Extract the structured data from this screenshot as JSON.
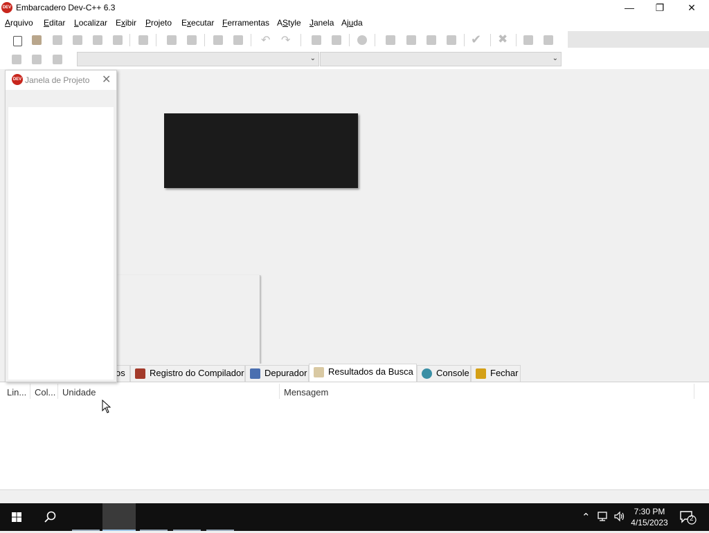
{
  "window": {
    "title": "Embarcadero Dev-C++ 6.3",
    "app_icon_text": "DEV C++",
    "minimize": "—",
    "restore": "❐",
    "close": "✕"
  },
  "menu": [
    {
      "label": "Arquivo",
      "key": "A",
      "rest": "rquivo"
    },
    {
      "label": "Editar",
      "key": "E",
      "rest": "ditar"
    },
    {
      "label": "Localizar",
      "key": "L",
      "rest": "ocalizar"
    },
    {
      "label": "Exibir",
      "pre": "E",
      "key": "x",
      "rest": "ibir"
    },
    {
      "label": "Projeto",
      "key": "P",
      "rest": "rojeto"
    },
    {
      "label": "Executar",
      "pre": "E",
      "key": "x",
      "rest": "ecutar"
    },
    {
      "label": "Ferramentas",
      "key": "F",
      "rest": "erramentas"
    },
    {
      "label": "AStyle",
      "pre": "A",
      "key": "S",
      "rest": "tyle"
    },
    {
      "label": "Janela",
      "key": "J",
      "rest": "anela"
    },
    {
      "label": "Ajuda",
      "pre": "Aj",
      "key": "u",
      "rest": "da"
    }
  ],
  "project_window": {
    "title": "Janela de Projeto",
    "close": "✕"
  },
  "bottom_tabs": [
    {
      "label": "os",
      "icon": "compiler-list-icon"
    },
    {
      "label": "Registro do Compilador",
      "icon": "compiler-log-icon"
    },
    {
      "label": "Depurador",
      "icon": "debugger-icon"
    },
    {
      "label": "Resultados da Busca",
      "icon": "search-results-icon",
      "active": true
    },
    {
      "label": "Console",
      "icon": "console-icon"
    },
    {
      "label": "Fechar",
      "icon": "close-panel-icon"
    }
  ],
  "results_columns": [
    "Lin...",
    "Col...",
    "Unidade",
    "Mensagem"
  ],
  "taskbar": {
    "time": "7:30 PM",
    "date": "4/15/2023",
    "notification_count": "2"
  },
  "colors": {
    "app_icon_red": "#c8261d",
    "taskbar_bg": "#101010",
    "black_box": "#1b1b1b"
  }
}
